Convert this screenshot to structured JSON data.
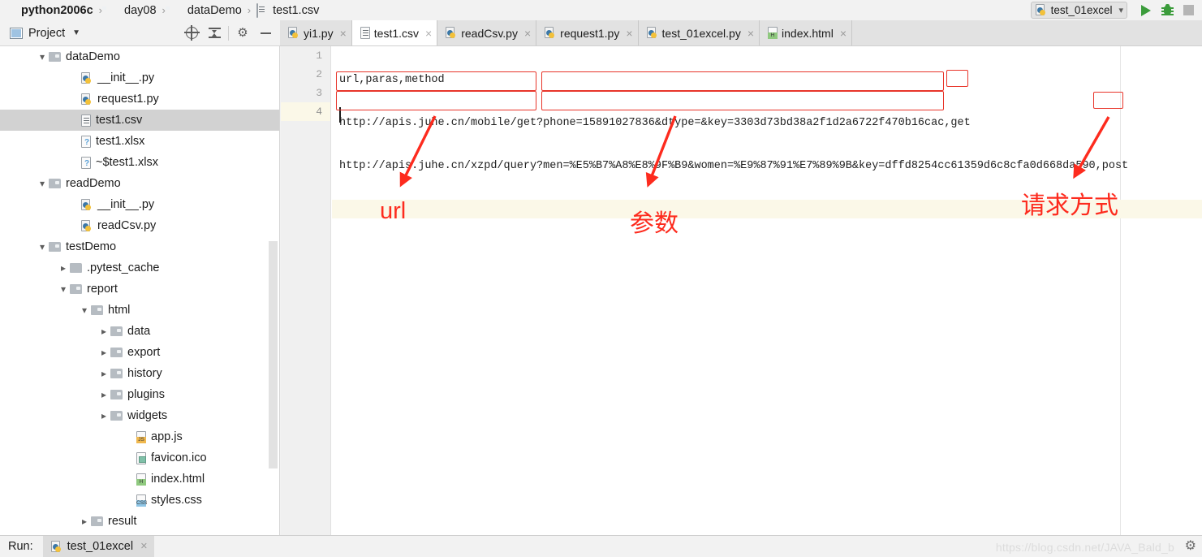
{
  "window": {
    "breadcrumb": [
      {
        "label": "python2006c",
        "icon": "module-icon",
        "bold": true
      },
      {
        "label": "day08",
        "icon": "folder-icon",
        "bold": false
      },
      {
        "label": "dataDemo",
        "icon": "folder-icon",
        "bold": false
      },
      {
        "label": "test1.csv",
        "icon": "csv-file-icon",
        "bold": false
      }
    ],
    "separator": "›"
  },
  "run_toolbar": {
    "config_name": "test_01excel",
    "config_icon": "python-file-icon",
    "dropdown_icon": "chevron-down-icon",
    "run_icon": "run-triangle-icon",
    "debug_icon": "debug-bug-icon",
    "stop_icon": "stop-square-icon"
  },
  "project_panel": {
    "title": "Project",
    "title_icon": "project-panel-icon",
    "dropdown_icon": "chevron-down-icon",
    "actions": [
      {
        "name": "locate-in-tree-icon"
      },
      {
        "name": "collapse-all-icon"
      },
      {
        "name": "settings-gear-icon"
      },
      {
        "name": "hide-panel-icon"
      }
    ],
    "tree": [
      {
        "label": "dataDemo",
        "indent": 2,
        "arrow": "down",
        "icon": "folder-icon",
        "selected": false
      },
      {
        "label": "__init__.py",
        "indent": 3,
        "arrow": "none",
        "icon": "python-file-icon",
        "selected": false
      },
      {
        "label": "request1.py",
        "indent": 3,
        "arrow": "none",
        "icon": "python-file-icon",
        "selected": false
      },
      {
        "label": "test1.csv",
        "indent": 3,
        "arrow": "none",
        "icon": "csv-file-icon",
        "selected": true
      },
      {
        "label": "test1.xlsx",
        "indent": 3,
        "arrow": "none",
        "icon": "unknown-file-icon",
        "selected": false
      },
      {
        "label": "~$test1.xlsx",
        "indent": 3,
        "arrow": "none",
        "icon": "unknown-file-icon",
        "selected": false
      },
      {
        "label": "readDemo",
        "indent": 2,
        "arrow": "down",
        "icon": "folder-icon",
        "selected": false
      },
      {
        "label": "__init__.py",
        "indent": 3,
        "arrow": "none",
        "icon": "python-file-icon",
        "selected": false
      },
      {
        "label": "readCsv.py",
        "indent": 3,
        "arrow": "none",
        "icon": "python-file-icon",
        "selected": false
      },
      {
        "label": "testDemo",
        "indent": 2,
        "arrow": "down",
        "icon": "folder-icon",
        "selected": false
      },
      {
        "label": ".pytest_cache",
        "indent": 3,
        "arrow": "right",
        "icon": "folder-plain-icon",
        "selected": false
      },
      {
        "label": "report",
        "indent": 3,
        "arrow": "down",
        "icon": "folder-icon",
        "selected": false
      },
      {
        "label": "html",
        "indent": 4,
        "arrow": "down",
        "icon": "folder-icon",
        "selected": false
      },
      {
        "label": "data",
        "indent": 5,
        "arrow": "right",
        "icon": "folder-icon",
        "selected": false
      },
      {
        "label": "export",
        "indent": 5,
        "arrow": "right",
        "icon": "folder-icon",
        "selected": false
      },
      {
        "label": "history",
        "indent": 5,
        "arrow": "right",
        "icon": "folder-icon",
        "selected": false
      },
      {
        "label": "plugins",
        "indent": 5,
        "arrow": "right",
        "icon": "folder-icon",
        "selected": false
      },
      {
        "label": "widgets",
        "indent": 5,
        "arrow": "right",
        "icon": "folder-icon",
        "selected": false
      },
      {
        "label": "app.js",
        "indent": 5,
        "arrow": "none",
        "icon": "js-file-icon",
        "selected": false
      },
      {
        "label": "favicon.ico",
        "indent": 5,
        "arrow": "none",
        "icon": "image-file-icon",
        "selected": false
      },
      {
        "label": "index.html",
        "indent": 5,
        "arrow": "none",
        "icon": "html-file-icon",
        "selected": false
      },
      {
        "label": "styles.css",
        "indent": 5,
        "arrow": "none",
        "icon": "css-file-icon",
        "selected": false
      },
      {
        "label": "result",
        "indent": 4,
        "arrow": "right",
        "icon": "folder-icon",
        "selected": false
      }
    ]
  },
  "editor": {
    "tabs": [
      {
        "label": "yi1.py",
        "icon": "python-file-icon",
        "active": false,
        "close_icon": "close-icon"
      },
      {
        "label": "test1.csv",
        "icon": "csv-file-icon",
        "active": true,
        "close_icon": "close-icon"
      },
      {
        "label": "readCsv.py",
        "icon": "python-file-icon",
        "active": false,
        "close_icon": "close-icon"
      },
      {
        "label": "request1.py",
        "icon": "python-file-icon",
        "active": false,
        "close_icon": "close-icon"
      },
      {
        "label": "test_01excel.py",
        "icon": "python-file-icon",
        "active": false,
        "close_icon": "close-icon"
      },
      {
        "label": "index.html",
        "icon": "html-file-icon",
        "active": false,
        "close_icon": "close-icon"
      }
    ],
    "close_glyph": "×",
    "line_numbers": [
      "1",
      "2",
      "3",
      "4"
    ],
    "current_line": 4,
    "lines": [
      "url,paras,method",
      "http://apis.juhe.cn/mobile/get?phone=15891027836&dtype=&key=3303d73bd38a2f1d2a6722f470b16cac,get",
      "http://apis.juhe.cn/xzpd/query?men=%E5%B7%A8%E8%9F%B9&women=%E9%87%91%E7%89%9B&key=dffd8254cc61359d6c8cfa0d668da590,post",
      ""
    ]
  },
  "annotations": {
    "color": "#fd2b1e",
    "labels": [
      {
        "text": "url",
        "lang": "latin"
      },
      {
        "text": "参数",
        "lang": "cjk"
      },
      {
        "text": "请求方式",
        "lang": "cjk"
      }
    ]
  },
  "bottom": {
    "run_label": "Run:",
    "run_tab": "test_01excel",
    "run_tab_icon": "python-file-icon",
    "close_glyph": "×",
    "watermark": "https://blog.csdn.net/JAVA_Bald_b",
    "settings_icon": "settings-gear-icon"
  }
}
